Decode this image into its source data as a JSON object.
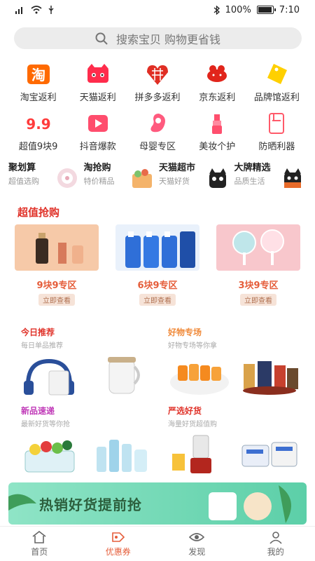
{
  "status_bar": {
    "battery": "100%",
    "time": "7:10",
    "battery_level": 1.0
  },
  "search": {
    "placeholder": "搜索宝贝  购物更省钱"
  },
  "categories": [
    {
      "label": "淘宝返利",
      "icon": "taobao-icon"
    },
    {
      "label": "天猫返利",
      "icon": "tmall-icon"
    },
    {
      "label": "拼多多返利",
      "icon": "pinduoduo-icon"
    },
    {
      "label": "京东返利",
      "icon": "jd-icon"
    },
    {
      "label": "品牌馆返利",
      "icon": "brand-tag-icon"
    },
    {
      "label": "超值9块9",
      "icon": "nine-nine-icon"
    },
    {
      "label": "抖音爆款",
      "icon": "douyin-icon"
    },
    {
      "label": "母婴专区",
      "icon": "baby-icon"
    },
    {
      "label": "美妆个护",
      "icon": "lipstick-icon"
    },
    {
      "label": "防晒利器",
      "icon": "sunscreen-icon"
    }
  ],
  "promos": [
    {
      "title": "聚划算",
      "subtitle": "超值选购"
    },
    {
      "title": "淘抢购",
      "subtitle": "特价精品"
    },
    {
      "title": "天猫超市",
      "subtitle": "天猫好货"
    },
    {
      "title": "大牌精选",
      "subtitle": "品质生活"
    }
  ],
  "section": {
    "title": "超值抢购"
  },
  "deals": [
    {
      "label": "9块9专区",
      "button": "立即查看"
    },
    {
      "label": "6块9专区",
      "button": "立即查看"
    },
    {
      "label": "3块9专区",
      "button": "立即查看"
    }
  ],
  "recommend": [
    {
      "title": "今日推荐",
      "subtitle": "每日单品推荐"
    },
    {
      "title": "好物专场",
      "subtitle": "好物专场等你拿"
    },
    {
      "title": "新品速递",
      "subtitle": "最新好货等你抢"
    },
    {
      "title": "严选好货",
      "subtitle": "海量好货超值购"
    }
  ],
  "banner": {
    "text": "热销好货提前抢"
  },
  "tabs": [
    {
      "label": "首页",
      "active": false
    },
    {
      "label": "优惠券",
      "active": true
    },
    {
      "label": "发现",
      "active": false
    },
    {
      "label": "我的",
      "active": false
    }
  ],
  "colors": {
    "accent": "#e55d3a",
    "section_red": "#e0332a"
  }
}
